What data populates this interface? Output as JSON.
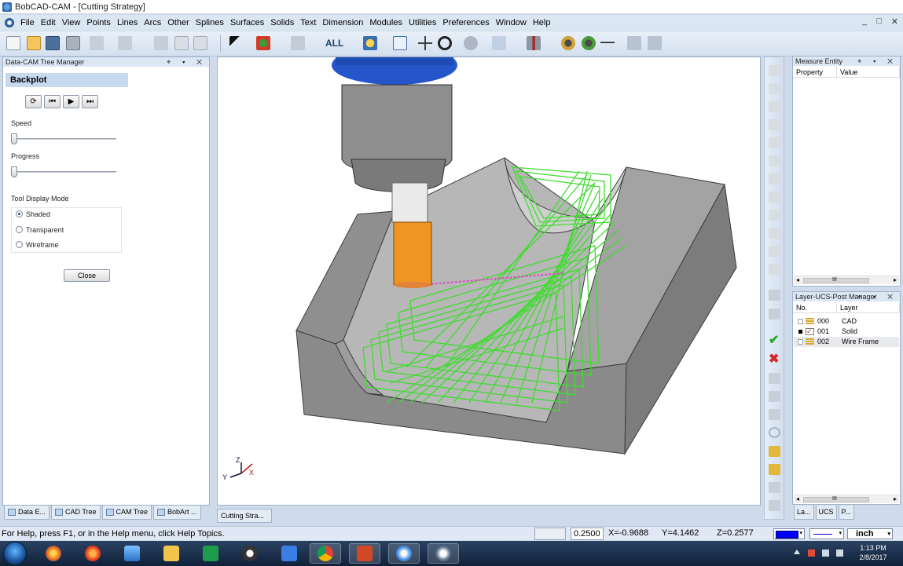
{
  "window": {
    "title": "BobCAD-CAM - [Cutting Strategy]"
  },
  "menu": {
    "items": [
      "File",
      "Edit",
      "View",
      "Points",
      "Lines",
      "Arcs",
      "Other",
      "Splines",
      "Surfaces",
      "Solids",
      "Text",
      "Dimension",
      "Modules",
      "Utilities",
      "Preferences",
      "Window",
      "Help"
    ],
    "window_controls": [
      "_",
      "□",
      "✕"
    ]
  },
  "toolbar": {
    "filter_label": "ALL"
  },
  "tree_manager": {
    "title": "Data-CAM Tree Manager",
    "title_controls": "⌖ ▾ ✕",
    "backplot": {
      "heading": "Backplot",
      "buttons": [
        "⟳",
        "⏮",
        "▶",
        "⏭"
      ],
      "speed_label": "Speed",
      "speed_value": 0,
      "progress_label": "Progress",
      "progress_value": 0,
      "tool_display_mode_label": "Tool Display Mode",
      "tool_display_modes": [
        "Shaded",
        "Transparent",
        "Wireframe"
      ],
      "selected_mode": "Shaded",
      "close_label": "Close"
    },
    "tabs": [
      "Data E...",
      "CAD Tree",
      "CAM Tree",
      "BobArt ..."
    ]
  },
  "viewport": {
    "tab_label": "Cutting Stra...",
    "axis_labels": {
      "x": "X",
      "y": "Y",
      "z": "Z"
    }
  },
  "measure_entity": {
    "title": "Measure Entity",
    "title_controls": "⌖ ▾ ✕",
    "columns": [
      "Property",
      "Value"
    ],
    "scroll_left": "◂",
    "scroll_thumb": "III",
    "scroll_right": "▸"
  },
  "layer_manager": {
    "title": "Layer-UCS-Post Manager",
    "title_controls": "⌖ ▾ ✕",
    "columns": [
      "No.",
      "Layer"
    ],
    "rows": [
      {
        "no": "000",
        "name": "CAD",
        "active": false,
        "selected": false
      },
      {
        "no": "001",
        "name": "Solid",
        "active": true,
        "selected": false
      },
      {
        "no": "002",
        "name": "Wire Frame",
        "active": false,
        "selected": true
      }
    ],
    "scroll_left": "◂",
    "scroll_thumb": "III",
    "scroll_right": "▸",
    "tabs": [
      "La...",
      "UCS",
      "P..."
    ]
  },
  "status": {
    "help_text": "For Help, press F1, or in the Help menu, click Help Topics.",
    "increment": "0.2500",
    "x": "X=-0.9688",
    "y": "Y=4.1462",
    "z": "Z=0.2577",
    "units": "inch",
    "dropdown_arrow": "▾",
    "active_color": "#0000ff"
  },
  "taskbar": {
    "time": "1:13 PM",
    "date": "2/8/2017"
  }
}
